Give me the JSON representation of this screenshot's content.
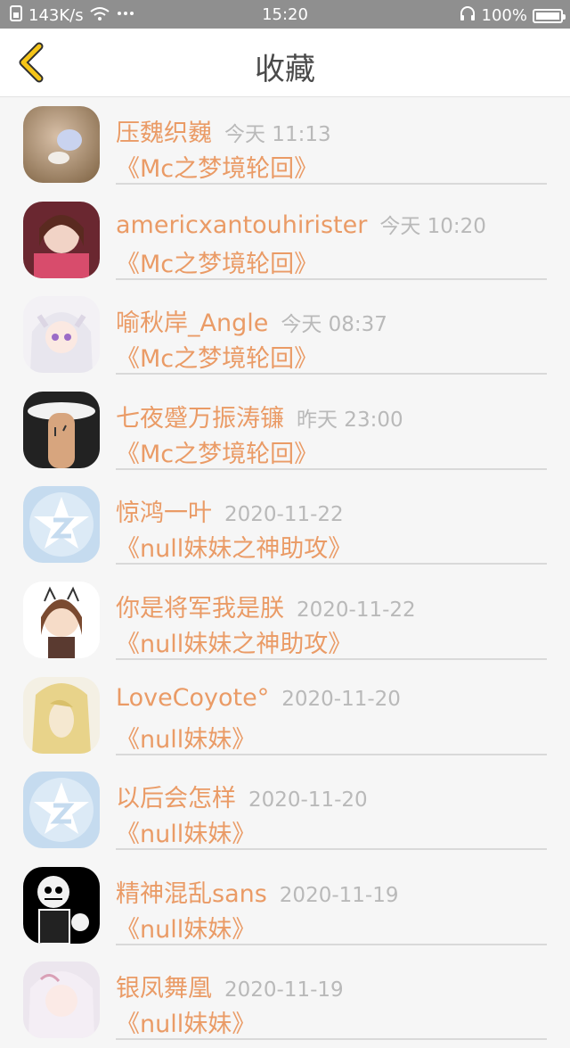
{
  "status_bar": {
    "speed": "143K/s",
    "time": "15:20",
    "battery": "100%",
    "battery_level": 1.0
  },
  "header": {
    "title": "收藏",
    "back_icon": "chevron-left-icon"
  },
  "favorites": [
    {
      "name": "压魏织巍",
      "time": "今天 11:13",
      "work": "《Mc之梦境轮回》",
      "avatar": "photo-avatar-1"
    },
    {
      "name": "americxantouhirister",
      "time": "今天 10:20",
      "work": "《Mc之梦境轮回》",
      "avatar": "photo-avatar-2"
    },
    {
      "name": "喻秋岸_Angle",
      "time": "今天 08:37",
      "work": "《Mc之梦境轮回》",
      "avatar": "photo-avatar-3"
    },
    {
      "name": "七夜蹙万振涛镰",
      "time": "昨天 23:00",
      "work": "《Mc之梦境轮回》",
      "avatar": "photo-avatar-4"
    },
    {
      "name": "惊鸿一叶",
      "time": "2020-11-22",
      "work": "《null妹妹之神助攻》",
      "avatar": "default-star-avatar"
    },
    {
      "name": "你是将军我是朕",
      "time": "2020-11-22",
      "work": "《null妹妹之神助攻》",
      "avatar": "photo-avatar-6"
    },
    {
      "name": "LoveCoyote°",
      "time": "2020-11-20",
      "work": "《null妹妹》",
      "avatar": "photo-avatar-7"
    },
    {
      "name": "以后会怎样",
      "time": "2020-11-20",
      "work": "《null妹妹》",
      "avatar": "default-star-avatar"
    },
    {
      "name": "精神混乱sans",
      "time": "2020-11-19",
      "work": "《null妹妹》",
      "avatar": "photo-avatar-9"
    },
    {
      "name": "银凤舞凰",
      "time": "2020-11-19",
      "work": "《null妹妹》",
      "avatar": "photo-avatar-10"
    }
  ],
  "colors": {
    "accent": "#ea9b66",
    "time": "#b9b9b9",
    "status_bar": "#8f8f8f",
    "back_icon": "#f5c518"
  }
}
